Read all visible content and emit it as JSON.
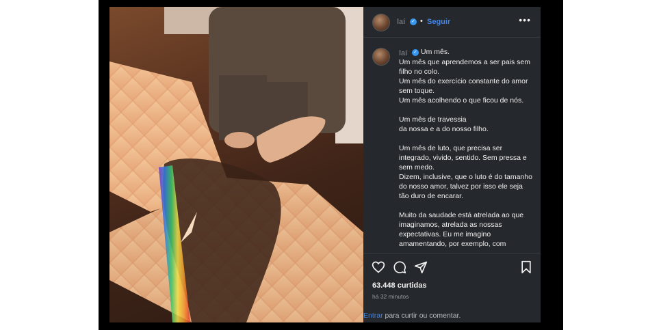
{
  "post": {
    "image_alt": "Feet on wooden floor with rainbow light",
    "header": {
      "username": "laí",
      "separator": "•",
      "follow_label": "Seguir",
      "more_icon": "more-options-icon"
    },
    "caption": {
      "username": "laí",
      "first_line": "Um mês.",
      "paragraphs": [
        "Um mês que aprendemos a ser pais sem filho no colo.\nUm mês do exercício constante do amor sem toque.\nUm mês acolhendo o que ficou de nós.",
        "Um mês de travessia\nda nossa e a do nosso filho.",
        "Um mês de luto, que precisa ser integrado, vivido, sentido. Sem pressa e sem medo.\nDizem, inclusive, que o luto é do tamanho do nosso amor, talvez por isso ele seja tão duro de encarar.",
        "Muito da saudade está atrelada ao que imaginamos, atrelada as nossas expectativas. Eu me imagino amamentando, por exemplo, com"
      ]
    },
    "actions": {
      "like_icon": "heart-icon",
      "comment_icon": "comment-icon",
      "share_icon": "share-icon",
      "save_icon": "bookmark-icon"
    },
    "likes": "63.448 curtidas",
    "timestamp": "há 32 minutos",
    "login_prompt": {
      "link": "Entrar",
      "text": " para curtir ou comentar."
    }
  },
  "colors": {
    "panel_bg": "#25282c",
    "accent": "#3f84e6",
    "verified": "#3897f0"
  }
}
